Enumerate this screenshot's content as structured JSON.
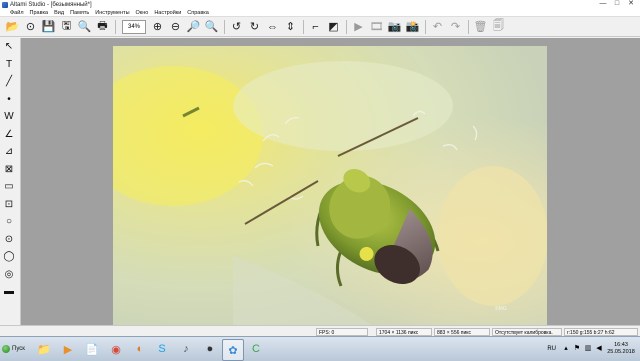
{
  "window": {
    "title": "Altami Studio - [безымянный*]",
    "controls": {
      "minimize": "—",
      "maximize": "□",
      "close": "✕"
    }
  },
  "menu": [
    "Файл",
    "Правка",
    "Вид",
    "Память",
    "Инструменты",
    "Окно",
    "Настройки",
    "Справка"
  ],
  "toolbar": {
    "zoom_value": "34%",
    "icons": {
      "open": "📂",
      "save_capture": "⊙",
      "save": "💾",
      "save_as": "🖫",
      "find": "🔍",
      "print": "🖶",
      "zoom_in": "⊕",
      "zoom_out": "⊖",
      "zoom_fit": "🔎",
      "zoom_tool": "🔍",
      "rotate_left": "↺",
      "rotate_right": "↻",
      "flip_h": "⇔",
      "flip_v": "⇕",
      "crop": "⌐",
      "adjust": "◩",
      "play": "▶",
      "video": "🎞",
      "capture": "📷",
      "capture_series": "📸",
      "undo": "↶",
      "redo": "↷",
      "delete": "🗑",
      "delete_all": "🗐"
    }
  },
  "tools": [
    {
      "name": "select-arrow-icon",
      "glyph": "↖"
    },
    {
      "name": "text-tool-icon",
      "glyph": "T"
    },
    {
      "name": "line-tool-icon",
      "glyph": "╱"
    },
    {
      "name": "point-tool-icon",
      "glyph": "•"
    },
    {
      "name": "polyline-tool-icon",
      "glyph": "W"
    },
    {
      "name": "angle-tool-icon",
      "glyph": "∠"
    },
    {
      "name": "angle-3pt-tool-icon",
      "glyph": "⊿"
    },
    {
      "name": "polygon-tool-icon",
      "glyph": "⊠"
    },
    {
      "name": "rectangle-tool-icon",
      "glyph": "▭"
    },
    {
      "name": "rect-select-tool-icon",
      "glyph": "⊡"
    },
    {
      "name": "circle-tool-icon",
      "glyph": "○"
    },
    {
      "name": "circle-center-tool-icon",
      "glyph": "⊙"
    },
    {
      "name": "ellipse-tool-icon",
      "glyph": "◯"
    },
    {
      "name": "ring-tool-icon",
      "glyph": "◎"
    },
    {
      "name": "scale-bar-tool-icon",
      "glyph": "▬"
    }
  ],
  "status": {
    "fps": "FPS: 0",
    "image_size": "1704 × 1136 пикс",
    "view_size": "883 × 556 пикс",
    "calibration": "Отсутствует калибровка.",
    "color": "r:150 g:155 b:27 h:62"
  },
  "taskbar": {
    "start_label": "Пуск",
    "apps": [
      {
        "name": "file-explorer-icon",
        "glyph": "📁",
        "color": "#e8c04a"
      },
      {
        "name": "media-player-icon",
        "glyph": "▶",
        "color": "#e8902a"
      },
      {
        "name": "documents-icon",
        "glyph": "📄",
        "color": "#5a8fd6"
      },
      {
        "name": "chrome-icon",
        "glyph": "◉",
        "color": "#d64a3a"
      },
      {
        "name": "firefox-icon",
        "glyph": "◐",
        "color": "#e07a20"
      },
      {
        "name": "skype-icon",
        "glyph": "S",
        "color": "#1aa3e8"
      },
      {
        "name": "audio-app-icon",
        "glyph": "♪",
        "color": "#555555"
      },
      {
        "name": "compass-app-icon",
        "glyph": "◔",
        "color": "#777777"
      },
      {
        "name": "record-app-icon",
        "glyph": "●",
        "color": "#333333"
      },
      {
        "name": "altami-studio-icon",
        "glyph": "✿",
        "color": "#3a8ad6"
      },
      {
        "name": "camtasia-icon",
        "glyph": "C",
        "color": "#3aa84a"
      }
    ],
    "tray": {
      "language": "RU",
      "time": "16:43",
      "date": "25.05.2018"
    }
  }
}
